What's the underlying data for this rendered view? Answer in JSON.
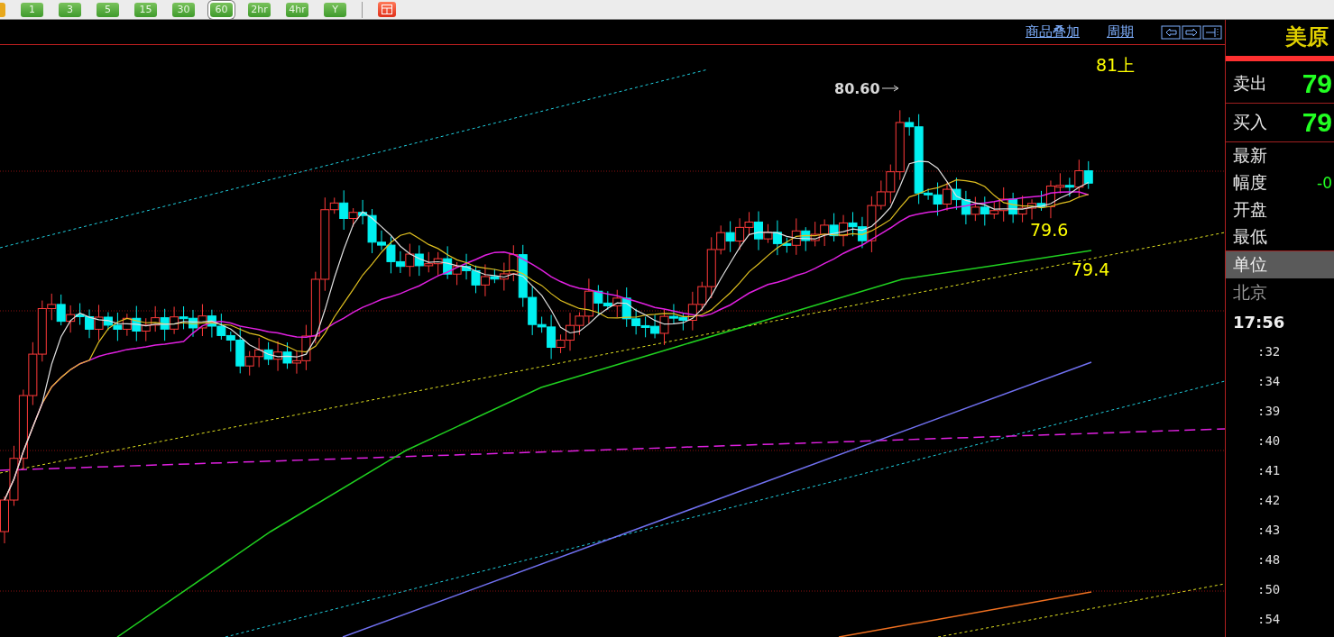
{
  "toolbar": {
    "periods": [
      {
        "label": "1",
        "selected": false
      },
      {
        "label": "3",
        "selected": false
      },
      {
        "label": "5",
        "selected": false
      },
      {
        "label": "15",
        "selected": false
      },
      {
        "label": "30",
        "selected": false
      },
      {
        "label": "60",
        "selected": true
      },
      {
        "label": "2hr",
        "selected": false
      },
      {
        "label": "4hr",
        "selected": false
      },
      {
        "label": "Y",
        "selected": false
      }
    ]
  },
  "chart": {
    "links": [
      "商品叠加",
      "周期"
    ],
    "labels": [
      {
        "kind": "price-arrow",
        "text": "80.60"
      },
      {
        "kind": "level",
        "text": "81上"
      },
      {
        "kind": "level",
        "text": "79.6"
      },
      {
        "kind": "level",
        "text": "79.4"
      }
    ]
  },
  "quote_panel": {
    "title": "美原",
    "rows": [
      {
        "kind": "big",
        "label": "卖出",
        "value": "79"
      },
      {
        "kind": "big",
        "label": "买入",
        "value": "79"
      },
      {
        "kind": "small",
        "label": "最新"
      },
      {
        "kind": "small",
        "label": "幅度",
        "value": "-0"
      },
      {
        "kind": "small",
        "label": "开盘"
      },
      {
        "kind": "small",
        "label": "最低"
      },
      {
        "kind": "highlight",
        "label": "单位"
      }
    ],
    "city": "北京",
    "time": "17:56",
    "ticks": [
      ":32",
      ":34",
      ":39",
      ":40",
      ":41",
      ":42",
      ":43",
      ":48",
      ":50",
      ":54"
    ]
  }
}
